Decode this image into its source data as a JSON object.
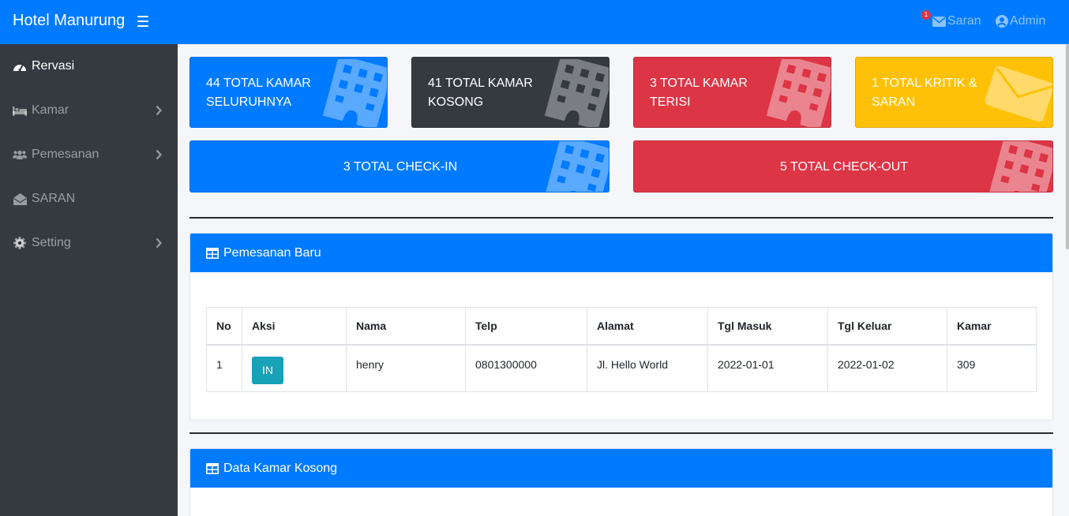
{
  "app": {
    "title": "Hotel Manurung"
  },
  "navbar": {
    "saran_label": "Saran",
    "saran_badge": "1",
    "admin_label": "Admin"
  },
  "sidebar": {
    "items": [
      {
        "label": "Rervasi",
        "icon": "tachometer-icon",
        "active": true
      },
      {
        "label": "Kamar",
        "icon": "bed-icon",
        "has_submenu": true
      },
      {
        "label": "Pemesanan",
        "icon": "users-icon",
        "has_submenu": true
      },
      {
        "label": "SARAN",
        "icon": "envelope-open-icon"
      },
      {
        "label": "Setting",
        "icon": "gear-icon",
        "has_submenu": true
      }
    ]
  },
  "stats": {
    "total_kamar": {
      "line1": "44 TOTAL KAMAR",
      "line2": "SELURUHNYA",
      "color": "#007bff",
      "icon": "building-icon"
    },
    "kamar_kosong": {
      "line1": "41 TOTAL KAMAR",
      "line2": "KOSONG",
      "color": "#343a40",
      "icon": "building-icon"
    },
    "kamar_terisi": {
      "line1": "3 TOTAL KAMAR",
      "line2": "TERISI",
      "color": "#dc3545",
      "icon": "building-icon"
    },
    "kritik_saran": {
      "line1": "1 TOTAL KRITIK &",
      "line2": "SARAN",
      "color": "#ffc107",
      "icon": "envelope-icon"
    },
    "checkin": {
      "label": "3 TOTAL CHECK-IN",
      "color": "#007bff",
      "icon": "building-icon"
    },
    "checkout": {
      "label": "5 TOTAL CHECK-OUT",
      "color": "#dc3545",
      "icon": "building-icon"
    }
  },
  "pemesanan_baru": {
    "title": "Pemesanan Baru",
    "columns": [
      "No",
      "Aksi",
      "Nama",
      "Telp",
      "Alamat",
      "Tgl Masuk",
      "Tgl Keluar",
      "Kamar"
    ],
    "rows": [
      {
        "no": "1",
        "aksi": "IN",
        "nama": "henry",
        "telp": "0801300000",
        "alamat": "Jl. Hello World",
        "tgl_masuk": "2022-01-01",
        "tgl_keluar": "2022-01-02",
        "kamar": "309"
      }
    ]
  },
  "data_kamar_kosong": {
    "title": "Data Kamar Kosong"
  }
}
